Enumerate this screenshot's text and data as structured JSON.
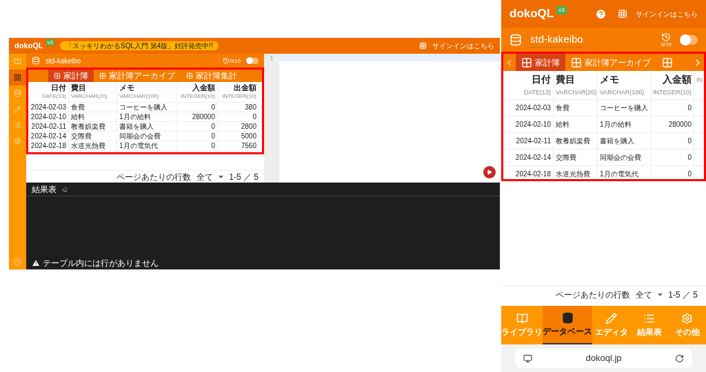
{
  "desktop": {
    "header": {
      "logo": "dokoQL",
      "version": "v3",
      "banner": "「スッキリわかるSQL入門 第4版」好評発売中!!",
      "signin": "サインインはこちら"
    },
    "sidebar": [
      {
        "kind": "library",
        "selected": false
      },
      {
        "kind": "grid",
        "selected": true
      },
      {
        "kind": "database",
        "selected": false
      },
      {
        "kind": "editor",
        "selected": false
      },
      {
        "kind": "results",
        "selected": false
      },
      {
        "kind": "settings",
        "selected": false
      }
    ],
    "database": {
      "name": "std-kakeibo",
      "history": "0/10",
      "switch_on": false
    },
    "tabs": [
      {
        "label": "家計簿",
        "selected": true
      },
      {
        "label": "家計簿アーカイブ",
        "selected": false
      },
      {
        "label": "家計簿集計",
        "selected": false
      }
    ],
    "table": {
      "columns": [
        {
          "name": "日付",
          "type": "DATE(13)"
        },
        {
          "name": "費目",
          "type": "VARCHAR(20)"
        },
        {
          "name": "メモ",
          "type": "VARCHAR(100)"
        },
        {
          "name": "入金額",
          "type": "INTEGER(10)"
        },
        {
          "name": "出金額",
          "type": "INTEGER(10)"
        }
      ],
      "rows": [
        [
          "2024-02-03",
          "食費",
          "コーヒーを購入",
          "0",
          "380"
        ],
        [
          "2024-02-10",
          "給料",
          "1月の給料",
          "280000",
          "0"
        ],
        [
          "2024-02-11",
          "教養娯楽費",
          "書籍を購入",
          "0",
          "2800"
        ],
        [
          "2024-02-14",
          "交際費",
          "同期会の会費",
          "0",
          "5000"
        ],
        [
          "2024-02-18",
          "水道光熱費",
          "1月の電気代",
          "0",
          "7560"
        ]
      ]
    },
    "pagination": {
      "label": "ページあたりの行数",
      "value": "全て",
      "range": "1-5 ／ 5"
    },
    "editor": {
      "line_numbers": [
        "1"
      ]
    },
    "results": {
      "title": "結果表",
      "message": "テーブル内には行がありません"
    }
  },
  "mobile": {
    "header": {
      "logo": "dokoQL",
      "version": "v3",
      "signin": "サインインはこちら"
    },
    "database": {
      "name": "std-kakeibo",
      "history": "0/10",
      "switch_on": false
    },
    "tabs": [
      {
        "label": "家計簿",
        "selected": true
      },
      {
        "label": "家計簿アーカイブ",
        "selected": false
      },
      {
        "selected": false
      }
    ],
    "table": {
      "columns": [
        {
          "name": "日付",
          "type": "DATE(13)"
        },
        {
          "name": "費目",
          "type": "VARCHAR(20)"
        },
        {
          "name": "メモ",
          "type": "VARCHAR(100)"
        },
        {
          "name": "入金額",
          "type": "INTEGER(10)"
        },
        {
          "type": "IN"
        }
      ],
      "rows": [
        [
          "2024-02-03",
          "食費",
          "コーヒーを購入",
          "0"
        ],
        [
          "2024-02-10",
          "給料",
          "1月の給料",
          "280000"
        ],
        [
          "2024-02-11",
          "教養娯楽費",
          "書籍を購入",
          "0"
        ],
        [
          "2024-02-14",
          "交際費",
          "同期会の会費",
          "0"
        ],
        [
          "2024-02-18",
          "水道光熱費",
          "1月の電気代",
          "0"
        ]
      ]
    },
    "pagination": {
      "label": "ページあたりの行数",
      "value": "全て",
      "range": "1-5 ／ 5"
    },
    "nav": [
      {
        "kind": "library",
        "label": "ライブラリ",
        "selected": false
      },
      {
        "kind": "database",
        "label": "データベース",
        "selected": true
      },
      {
        "kind": "editor",
        "label": "エディタ",
        "selected": false
      },
      {
        "kind": "results",
        "label": "結果表",
        "selected": false
      },
      {
        "kind": "settings",
        "label": "その他",
        "selected": false
      }
    ],
    "browser": {
      "url": "dokoql.jp"
    }
  }
}
